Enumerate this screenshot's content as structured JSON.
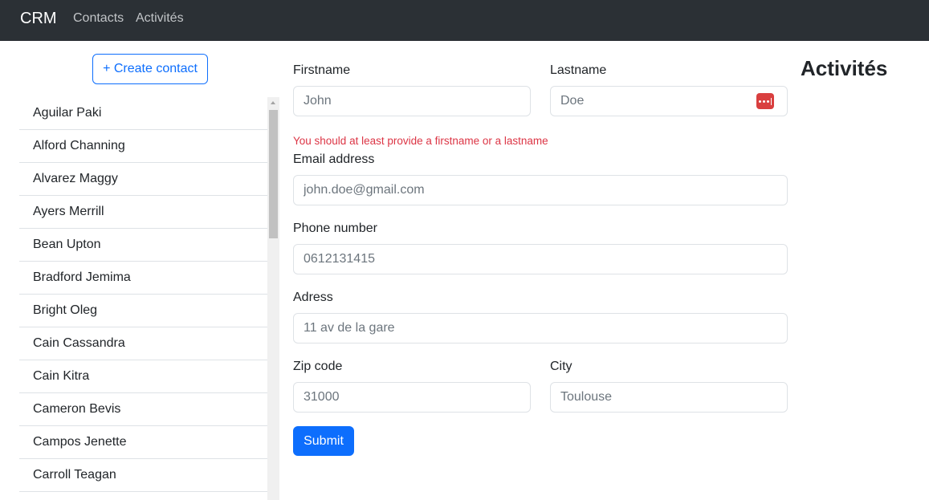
{
  "navbar": {
    "brand": "CRM",
    "links": [
      "Contacts",
      "Activités"
    ]
  },
  "sidebar": {
    "create_button": "+ Create contact",
    "contacts": [
      "Aguilar Paki",
      "Alford Channing",
      "Alvarez Maggy",
      "Ayers Merrill",
      "Bean Upton",
      "Bradford Jemima",
      "Bright Oleg",
      "Cain Cassandra",
      "Cain Kitra",
      "Cameron Bevis",
      "Campos Jenette",
      "Carroll Teagan"
    ]
  },
  "form": {
    "firstname": {
      "label": "Firstname",
      "placeholder": "John",
      "value": ""
    },
    "lastname": {
      "label": "Lastname",
      "placeholder": "Doe",
      "value": ""
    },
    "error": "You should at least provide a firstname or a lastname",
    "email": {
      "label": "Email address",
      "placeholder": "john.doe@gmail.com",
      "value": ""
    },
    "phone": {
      "label": "Phone number",
      "placeholder": "0612131415",
      "value": ""
    },
    "address": {
      "label": "Adress",
      "placeholder": "11 av de la gare",
      "value": ""
    },
    "zip": {
      "label": "Zip code",
      "placeholder": "31000",
      "value": ""
    },
    "city": {
      "label": "City",
      "placeholder": "Toulouse",
      "value": ""
    },
    "submit": "Submit"
  },
  "activities": {
    "title": "Activités"
  },
  "icons": {
    "password_manager": "password-manager-icon"
  },
  "colors": {
    "navbar": "#2b3035",
    "primary": "#0d6efd",
    "error": "#dc3545",
    "password_icon": "#d93f3f"
  }
}
